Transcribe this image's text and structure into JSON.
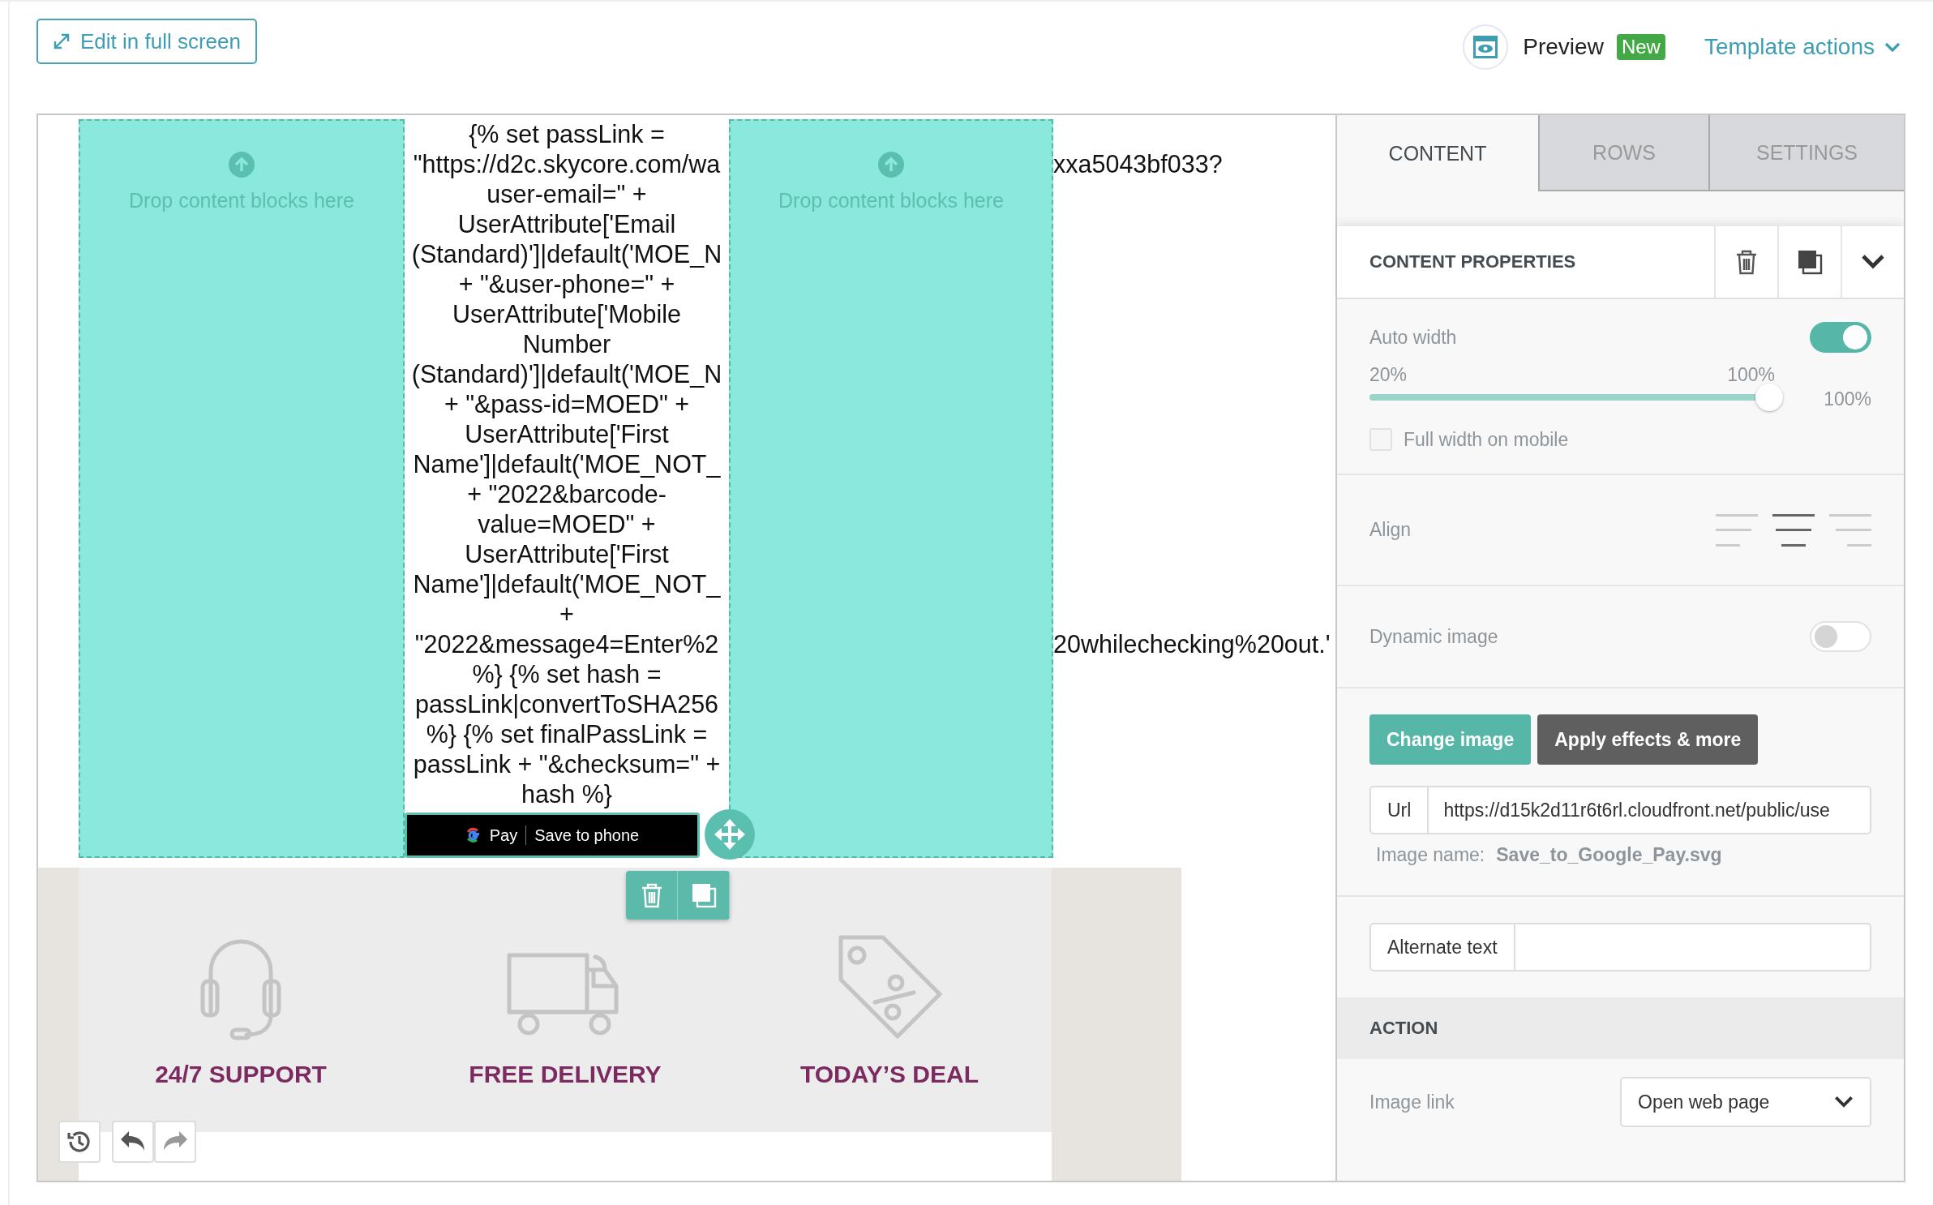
{
  "toolbar": {
    "fullscreen_button": "Edit in full screen",
    "preview": "Preview",
    "new_badge": "New",
    "template_actions": "Template actions"
  },
  "canvas": {
    "drop_zones": [
      {
        "text": "Drop content blocks here"
      },
      {
        "text": "Drop content blocks here"
      }
    ],
    "code_lines": [
      {
        "text": "{% set passLink ="
      },
      {
        "text": "\"https://d2c.skycore.com/wa",
        "overflow": "xxa5043bf033?"
      },
      {
        "text": "user-email=\" +"
      },
      {
        "text": "UserAttribute['Email"
      },
      {
        "text": "(Standard)']|default('MOE_N"
      },
      {
        "text": "+ \"&user-phone=\" +"
      },
      {
        "text": "UserAttribute['Mobile"
      },
      {
        "text": "Number"
      },
      {
        "text": "(Standard)']|default('MOE_N"
      },
      {
        "text": "+ \"&pass-id=MOED\" +"
      },
      {
        "text": "UserAttribute['First"
      },
      {
        "text": "Name']|default('MOE_NOT_"
      },
      {
        "text": "+ \"2022&barcode-"
      },
      {
        "text": "value=MOED\" +"
      },
      {
        "text": "UserAttribute['First"
      },
      {
        "text": "Name']|default('MOE_NOT_"
      },
      {
        "text": "+"
      },
      {
        "text": "\"2022&message4=Enter%2",
        "overflow": "20whilechecking%20out.'"
      },
      {
        "text": "%} {% set hash ="
      },
      {
        "text": "passLink|convertToSHA256"
      },
      {
        "text": "%} {% set finalPassLink ="
      },
      {
        "text": "passLink + \"&checksum=\" +"
      },
      {
        "text": "hash %}"
      }
    ],
    "gpay_button": {
      "brand": "Pay",
      "label": "Save to phone"
    },
    "features": [
      {
        "kind": "headset",
        "label": "24/7 SUPPORT"
      },
      {
        "kind": "truck",
        "label": "FREE DELIVERY"
      },
      {
        "kind": "tag",
        "label": "TODAY’S DEAL"
      }
    ]
  },
  "panel": {
    "tabs": [
      {
        "label": "CONTENT",
        "selected": true
      },
      {
        "label": "ROWS",
        "selected": false
      },
      {
        "label": "SETTINGS",
        "selected": false
      }
    ],
    "section_title": "CONTENT PROPERTIES",
    "auto_width": {
      "label": "Auto width",
      "on": true
    },
    "width_slider": {
      "min_label": "20%",
      "max_label": "100%",
      "reading": "100%",
      "level": 1
    },
    "full_width_mobile": {
      "label": "Full width on mobile",
      "checked": false
    },
    "align": {
      "label": "Align",
      "options": [
        {
          "kind": "left",
          "selected": false
        },
        {
          "kind": "center",
          "selected": true
        },
        {
          "kind": "right",
          "selected": false
        }
      ]
    },
    "dynamic_image": {
      "label": "Dynamic image",
      "on": false
    },
    "buttons": [
      {
        "kind": "primary",
        "label": "Change image"
      },
      {
        "kind": "secondary",
        "label": "Apply effects & more"
      }
    ],
    "url": {
      "label": "Url",
      "value": "https://d15k2d11r6t6rl.cloudfront.net/public/use"
    },
    "image_name": {
      "label": "Image name:",
      "value": "Save_to_Google_Pay.svg"
    },
    "alt_text": {
      "label": "Alternate text"
    },
    "action": {
      "title": "ACTION",
      "image_link_label": "Image link",
      "image_link_value": "Open web page"
    }
  }
}
